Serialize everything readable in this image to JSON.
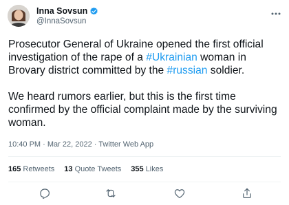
{
  "author": {
    "name": "Inna Sovsun",
    "handle": "@InnaSovsun",
    "verified_icon": "verified-badge-icon"
  },
  "tweet": {
    "p1": [
      {
        "text": "Prosecutor General of Ukraine opened the first official investigation of the rape of a ",
        "tag": false
      },
      {
        "text": "#Ukrainian",
        "tag": true
      },
      {
        "text": " woman in Brovary district committed by the ",
        "tag": false
      },
      {
        "text": "#russian",
        "tag": true
      },
      {
        "text": " soldier.",
        "tag": false
      }
    ],
    "p2": "We heard rumors earlier, but this is the first time confirmed by the official complaint made by the surviving woman."
  },
  "meta": {
    "time": "10:40 PM",
    "sep1": " · ",
    "date": "Mar 22, 2022",
    "sep2": " · ",
    "source": "Twitter Web App"
  },
  "stats": {
    "retweets_count": "165",
    "retweets_label": " Retweets",
    "quotes_count": "13",
    "quotes_label": " Quote Tweets",
    "likes_count": "355",
    "likes_label": " Likes"
  },
  "icons": {
    "more": "more-dots-icon",
    "reply": "reply-icon",
    "retweet": "retweet-icon",
    "like": "heart-icon",
    "share": "share-icon"
  },
  "colors": {
    "accent": "#1d9bf0",
    "text": "#0f1419",
    "muted": "#536471",
    "divider": "#eff3f4"
  }
}
